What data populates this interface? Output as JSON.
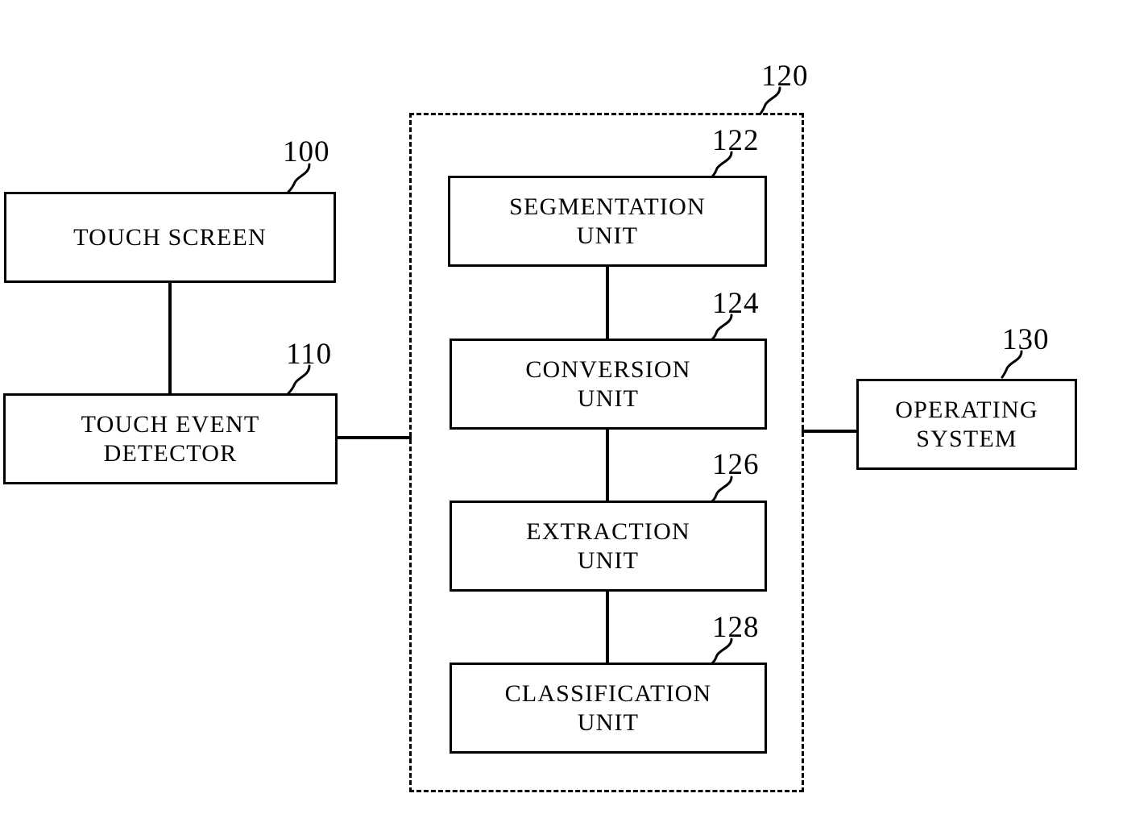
{
  "figure": {
    "type": "patent-block-diagram",
    "background_color": "#ffffff",
    "line_color": "#000000"
  },
  "blocks": {
    "touch_screen": {
      "label": "TOUCH SCREEN",
      "ref": "100",
      "border": "solid"
    },
    "touch_event_detector": {
      "label": "TOUCH EVENT\nDETECTOR",
      "ref": "110",
      "border": "solid"
    },
    "processor_group": {
      "ref": "120",
      "border": "dashed"
    },
    "segmentation_unit": {
      "label": "SEGMENTATION\nUNIT",
      "ref": "122",
      "border": "solid"
    },
    "conversion_unit": {
      "label": "CONVERSION\nUNIT",
      "ref": "124",
      "border": "solid"
    },
    "extraction_unit": {
      "label": "EXTRACTION\nUNIT",
      "ref": "126",
      "border": "solid"
    },
    "classification_unit": {
      "label": "CLASSIFICATION\nUNIT",
      "ref": "128",
      "border": "solid"
    },
    "operating_system": {
      "label": "OPERATING\nSYSTEM",
      "ref": "130",
      "border": "solid"
    }
  },
  "connections": [
    {
      "from": "touch_screen",
      "to": "touch_event_detector",
      "orientation": "vertical"
    },
    {
      "from": "touch_event_detector",
      "to": "processor_group",
      "orientation": "horizontal"
    },
    {
      "from": "segmentation_unit",
      "to": "conversion_unit",
      "orientation": "vertical"
    },
    {
      "from": "conversion_unit",
      "to": "extraction_unit",
      "orientation": "vertical"
    },
    {
      "from": "extraction_unit",
      "to": "classification_unit",
      "orientation": "vertical"
    },
    {
      "from": "processor_group",
      "to": "operating_system",
      "orientation": "horizontal"
    }
  ]
}
